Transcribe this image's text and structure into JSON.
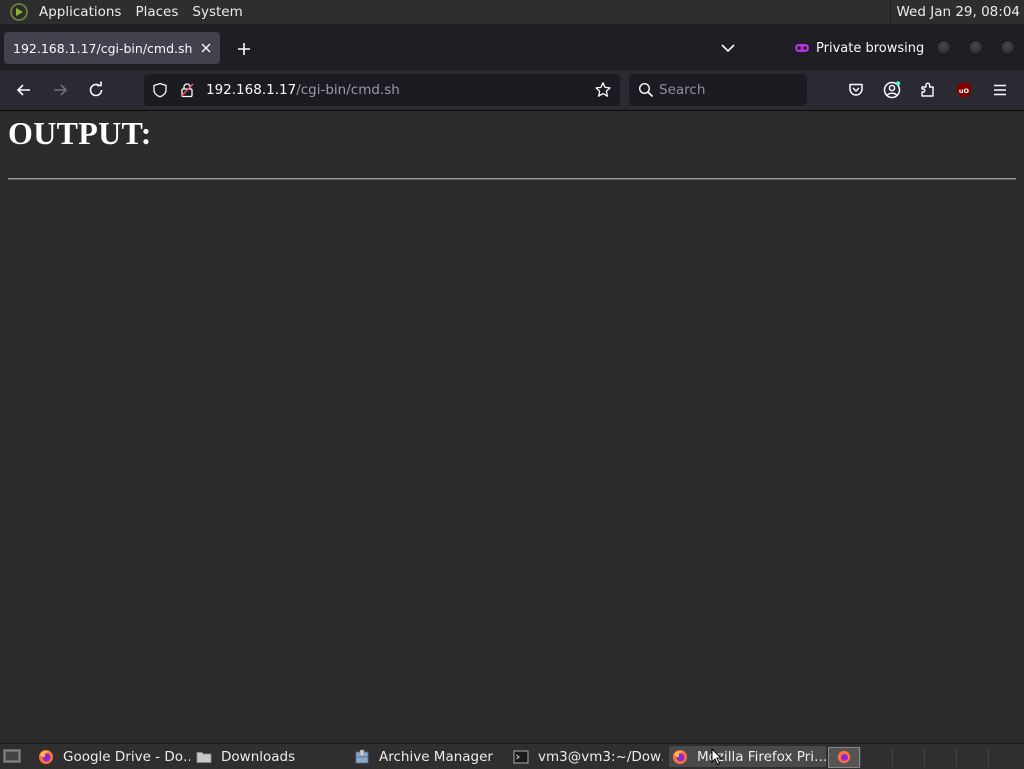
{
  "top_panel": {
    "menus": [
      "Applications",
      "Places",
      "System"
    ],
    "clock": "Wed Jan 29, 08:04"
  },
  "browser": {
    "tab": {
      "title": "192.168.1.17/cgi-bin/cmd.sh"
    },
    "private_label": "Private browsing",
    "url": {
      "host": "192.168.1.17",
      "path": "/cgi-bin/cmd.sh"
    },
    "search_placeholder": "Search"
  },
  "page": {
    "heading": "OUTPUT:"
  },
  "taskbar": {
    "tasks": [
      {
        "label": "Google Drive - Do…",
        "icon": "firefox-icon"
      },
      {
        "label": "Downloads",
        "icon": "folder-icon"
      },
      {
        "label": "Archive Manager",
        "icon": "archive-manager-icon"
      },
      {
        "label": "vm3@vm3:~/Dow…",
        "icon": "terminal-icon"
      },
      {
        "label": "Mozilla Firefox Pri…",
        "icon": "firefox-icon"
      }
    ]
  },
  "colors": {
    "panel_bg": "#2e2e2e",
    "tabbar_bg": "#1f1e23",
    "navbar_bg": "#2b2a33",
    "urlbar_bg": "#1c1b22",
    "page_bg": "#2b2b2b",
    "private_accent": "#b833e1",
    "ublock_red": "#800000"
  }
}
